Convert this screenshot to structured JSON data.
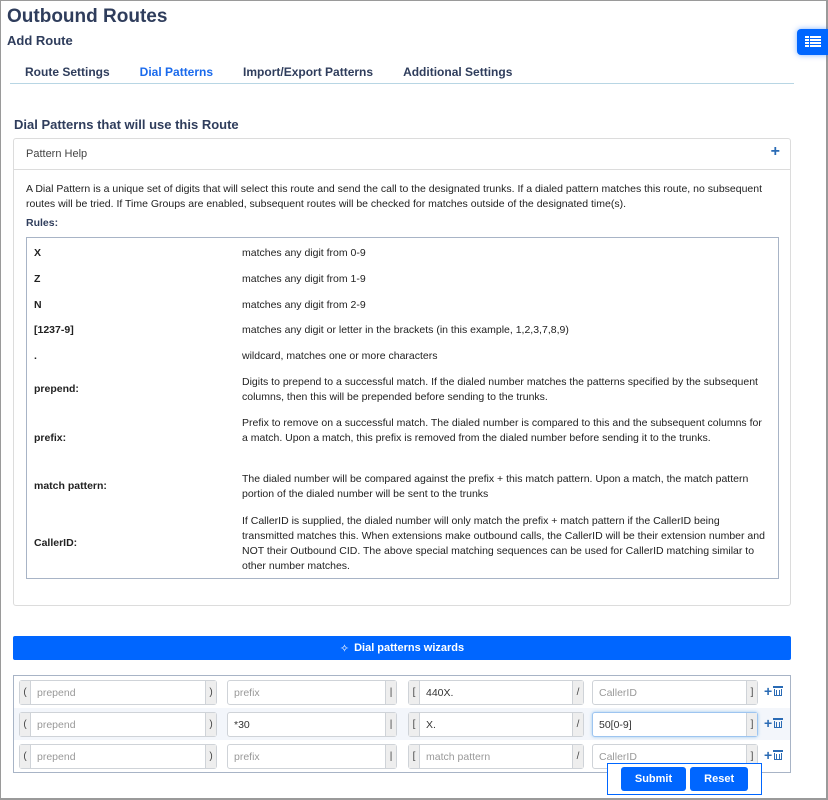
{
  "header": {
    "title": "Outbound Routes",
    "subtitle": "Add Route"
  },
  "tabs": [
    {
      "label": "Route Settings",
      "active": false
    },
    {
      "label": "Dial Patterns",
      "active": true
    },
    {
      "label": "Import/Export Patterns",
      "active": false
    },
    {
      "label": "Additional Settings",
      "active": false
    }
  ],
  "side_toggle": {
    "icon": "list-icon",
    "color": "#0066ff"
  },
  "section": {
    "title": "Dial Patterns that will use this Route"
  },
  "help_panel": {
    "heading": "Pattern Help",
    "toggle_icon": "plus-icon",
    "intro": "A Dial Pattern is a unique set of digits that will select this route and send the call to the designated trunks. If a dialed pattern matches this route, no subsequent routes will be tried. If Time Groups are enabled, subsequent routes will be checked for matches outside of the designated time(s).",
    "rules_label": "Rules:",
    "rules": [
      {
        "key": "X",
        "desc": "matches any digit from 0-9"
      },
      {
        "key": "Z",
        "desc": "matches any digit from 1-9"
      },
      {
        "key": "N",
        "desc": "matches any digit from 2-9"
      },
      {
        "key": "[1237-9]",
        "desc": "matches any digit or letter in the brackets (in this example, 1,2,3,7,8,9)"
      },
      {
        "key": ".",
        "desc": "wildcard, matches one or more characters"
      },
      {
        "key": "prepend:",
        "desc": "Digits to prepend to a successful match. If the dialed number matches the patterns specified by the subsequent columns, then this will be prepended before sending to the trunks."
      },
      {
        "key": "prefix:",
        "desc": "Prefix to remove on a successful match. The dialed number is compared to this and the subsequent columns for a match. Upon a match, this prefix is removed from the dialed number before sending it to the trunks."
      },
      {
        "key": "match pattern:",
        "desc": "The dialed number will be compared against the prefix + this match pattern. Upon a match, the match pattern portion of the dialed number will be sent to the trunks"
      },
      {
        "key": "CallerID:",
        "desc": "If CallerID is supplied, the dialed number will only match the prefix + match pattern if the CallerID being transmitted matches this. When extensions make outbound calls, the CallerID will be their extension number and NOT their Outbound CID. The above special matching sequences can be used for CallerID matching similar to other number matches."
      }
    ]
  },
  "wizard_button": {
    "label": "Dial patterns wizards",
    "icon": "magic-wand-icon"
  },
  "addons": {
    "prepend_open": "(",
    "prepend_close": ")",
    "prefix_close": "|",
    "match_open": "[",
    "match_close": "/",
    "callerid_close": "]"
  },
  "placeholders": {
    "prepend": "prepend",
    "prefix": "prefix",
    "match": "match pattern",
    "callerid": "CallerID"
  },
  "pattern_rows": [
    {
      "prepend": "",
      "prefix": "",
      "match": "440X.",
      "callerid": ""
    },
    {
      "prepend": "",
      "prefix": "*30",
      "match": "X.",
      "callerid": "50[0-9]"
    },
    {
      "prepend": "",
      "prefix": "",
      "match": "",
      "callerid": ""
    }
  ],
  "actions": {
    "submit": "Submit",
    "reset": "Reset"
  },
  "colors": {
    "accent": "#0066ff",
    "heading": "#2f3d5c",
    "active_tab": "#1a6aec",
    "icon_blue": "#2a6bb5"
  }
}
